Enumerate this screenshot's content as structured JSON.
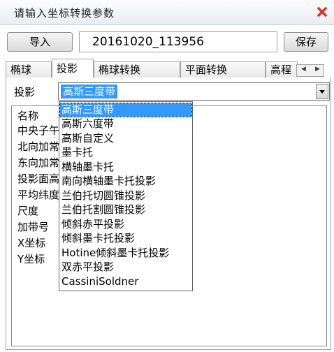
{
  "window": {
    "title": "请输入坐标转换参数",
    "close_color": "#d9302a"
  },
  "toolbar": {
    "import_label": "导入",
    "name_value": "20161020_113956",
    "save_label": "保存"
  },
  "tabs": [
    {
      "label": "椭球",
      "active": false
    },
    {
      "label": "投影",
      "active": true
    },
    {
      "label": "椭球转换",
      "active": false
    },
    {
      "label": "平面转换",
      "active": false
    },
    {
      "label": "高程",
      "active": false
    }
  ],
  "projection": {
    "label": "投影",
    "selected": "高斯三度带",
    "options": [
      "高斯三度带",
      "高斯六度带",
      "高斯自定义",
      "墨卡托",
      "横轴墨卡托",
      "南向横轴墨卡托投影",
      "兰伯托切圆锥投影",
      "兰伯托割圆锥投影",
      "倾斜赤平投影",
      "倾斜墨卡托投影",
      "Hotine倾斜墨卡托投影",
      "双赤平投影",
      "CassiniSoldner"
    ]
  },
  "params": {
    "header": "名称",
    "rows": [
      "中央子午线",
      "北向加常数",
      "东向加常数",
      "投影面高程",
      "平均纬度",
      "尺度",
      "加带号",
      "X坐标",
      "Y坐标"
    ]
  },
  "colors": {
    "selection": "#3399ff",
    "window_bg": "#ffffff"
  }
}
